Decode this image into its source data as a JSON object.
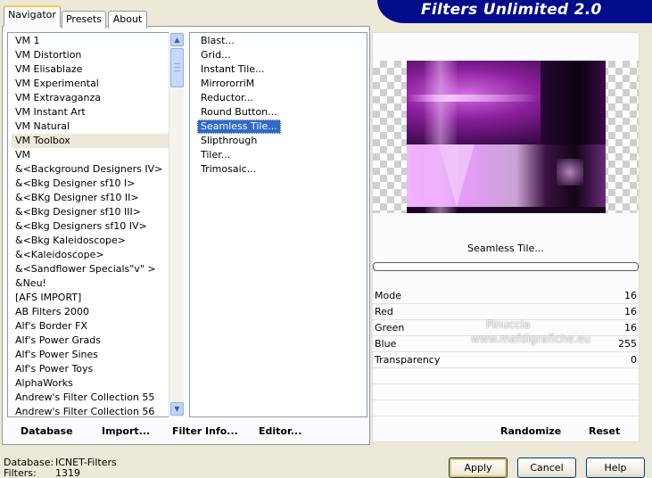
{
  "header": {
    "title": "Filters Unlimited 2.0",
    "color": "#000c8a"
  },
  "tabs": [
    {
      "label": "Navigator",
      "active": true
    },
    {
      "label": "Presets",
      "active": false
    },
    {
      "label": "About",
      "active": false
    }
  ],
  "filter_list": {
    "selected": "VM Toolbox",
    "items": [
      "VM 1",
      "VM Distortion",
      "VM Elisablaze",
      "VM Experimental",
      "VM Extravaganza",
      "VM Instant Art",
      "VM Natural",
      "VM Toolbox",
      "VM",
      "&<Background Designers IV>",
      "&<Bkg Designer sf10 I>",
      "&<BKg Designer sf10 II>",
      "&<Bkg Designer sf10 III>",
      "&<Bkg Designers sf10 IV>",
      "&<Bkg Kaleidoscope>",
      "&<Kaleidoscope>",
      "&<Sandflower Specials\"v\" >",
      "&Neu!",
      "[AFS IMPORT]",
      "AB Filters 2000",
      "Alf's Border FX",
      "Alf's Power Grads",
      "Alf's Power Sines",
      "Alf's Power Toys",
      "AlphaWorks",
      "Andrew's Filter Collection 55",
      "Andrew's Filter Collection 56"
    ]
  },
  "effect_list": {
    "selected": "Seamless Tile...",
    "items": [
      "Blast...",
      "Grid...",
      "Instant Tile...",
      "MirrororriM",
      "Reductor...",
      "Round Button...",
      "Seamless Tile...",
      "Slipthrough",
      "Tiler...",
      "Trimosaic..."
    ]
  },
  "left_buttons": {
    "database": "Database",
    "import": "Import...",
    "filter_info": "Filter Info...",
    "editor": "Editor..."
  },
  "preview": {
    "effect_name": "Seamless Tile...",
    "progress_fraction": 0.0
  },
  "params": [
    {
      "name": "Mode",
      "value": "16"
    },
    {
      "name": "Red",
      "value": "16"
    },
    {
      "name": "Green",
      "value": "16"
    },
    {
      "name": "Blue",
      "value": "255"
    },
    {
      "name": "Transparency",
      "value": "0"
    }
  ],
  "watermark": {
    "line1": "Pinuccia",
    "line2": "www.mafdigrafiche.eu"
  },
  "right_buttons": {
    "randomize": "Randomize",
    "reset": "Reset"
  },
  "status": {
    "database_label": "Database:",
    "database_value": "ICNET-Filters",
    "filters_label": "Filters:",
    "filters_value": "1319"
  },
  "dialog_buttons": {
    "apply": "Apply",
    "cancel": "Cancel",
    "help": "Help"
  }
}
